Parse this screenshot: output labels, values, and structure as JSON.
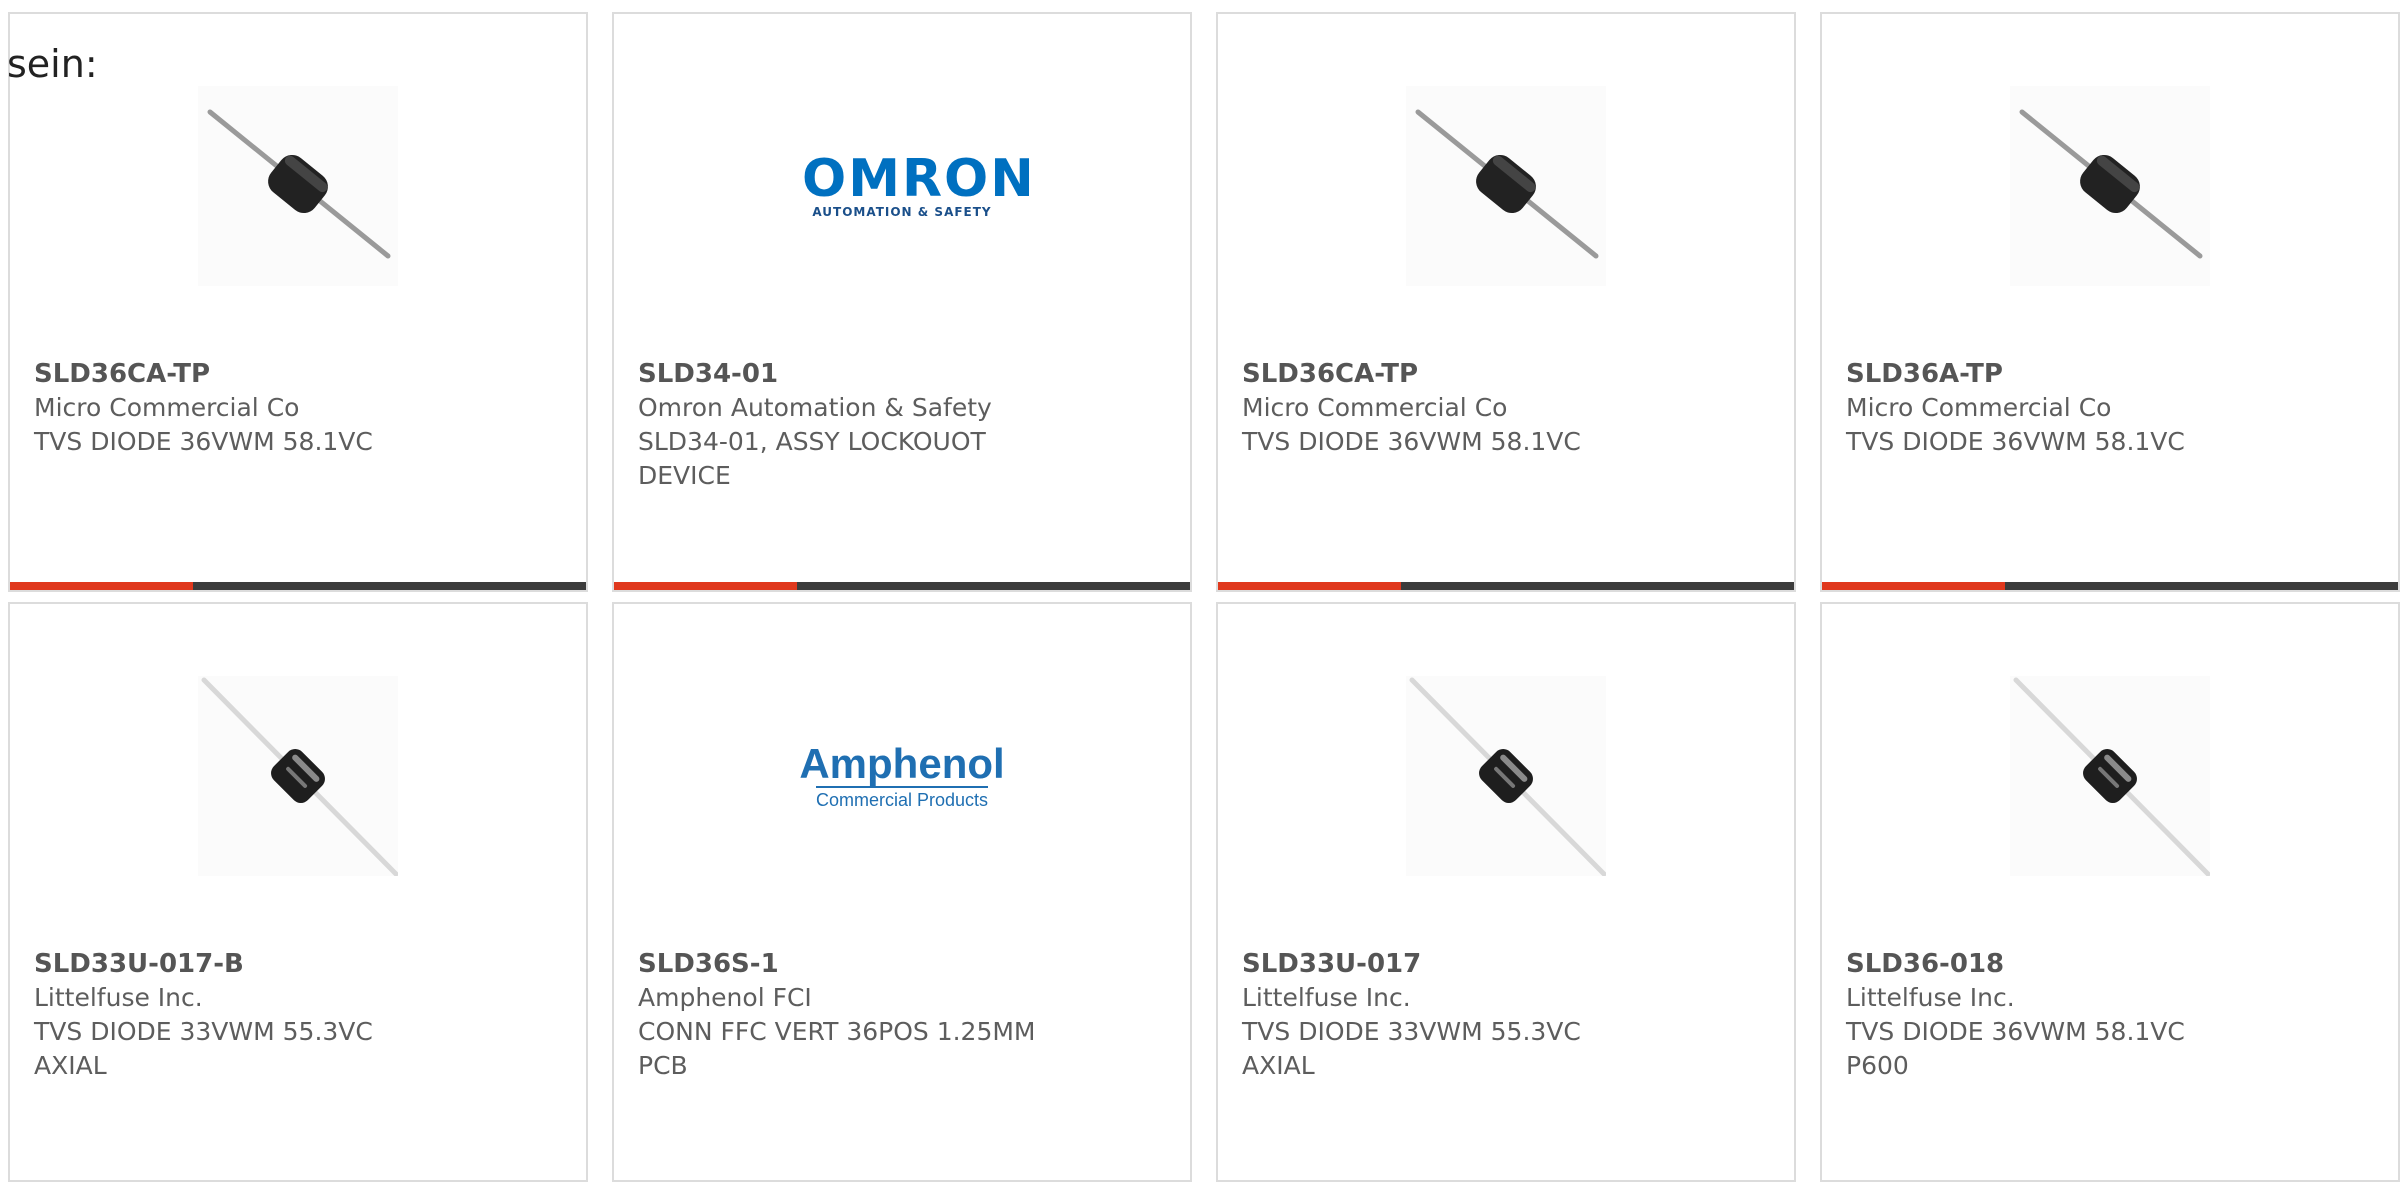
{
  "intro_text": "sein:",
  "accent_color": "#e0381d",
  "products": [
    {
      "part": "SLD36CA-TP",
      "manufacturer": "Micro Commercial Co",
      "description": "TVS DIODE 36VWM 58.1VC",
      "image": "diode-black-icon"
    },
    {
      "part": "SLD34-01",
      "manufacturer": "Omron Automation & Safety",
      "description": "SLD34-01, ASSY LOCKOUOT DEVICE",
      "image": "omron-logo",
      "logo_text": "OMRON",
      "logo_subtext": "AUTOMATION & SAFETY"
    },
    {
      "part": "SLD36CA-TP",
      "manufacturer": "Micro Commercial Co",
      "description": "TVS DIODE 36VWM 58.1VC",
      "image": "diode-black-icon"
    },
    {
      "part": "SLD36A-TP",
      "manufacturer": "Micro Commercial Co",
      "description": "TVS DIODE 36VWM 58.1VC",
      "image": "diode-black-icon"
    },
    {
      "part": "SLD33U-017-B",
      "manufacturer": "Littelfuse Inc.",
      "description": "TVS DIODE 33VWM 55.3VC AXIAL",
      "image": "diode-silver-icon"
    },
    {
      "part": "SLD36S-1",
      "manufacturer": "Amphenol FCI",
      "description": "CONN FFC VERT 36POS 1.25MM PCB",
      "image": "amphenol-logo",
      "logo_text": "Amphenol",
      "logo_subtext": "Commercial Products"
    },
    {
      "part": "SLD33U-017",
      "manufacturer": "Littelfuse Inc.",
      "description": "TVS DIODE 33VWM 55.3VC AXIAL",
      "image": "diode-silver-icon"
    },
    {
      "part": "SLD36-018",
      "manufacturer": "Littelfuse Inc.",
      "description": "TVS DIODE 36VWM 58.1VC P600",
      "image": "diode-silver-icon"
    }
  ]
}
